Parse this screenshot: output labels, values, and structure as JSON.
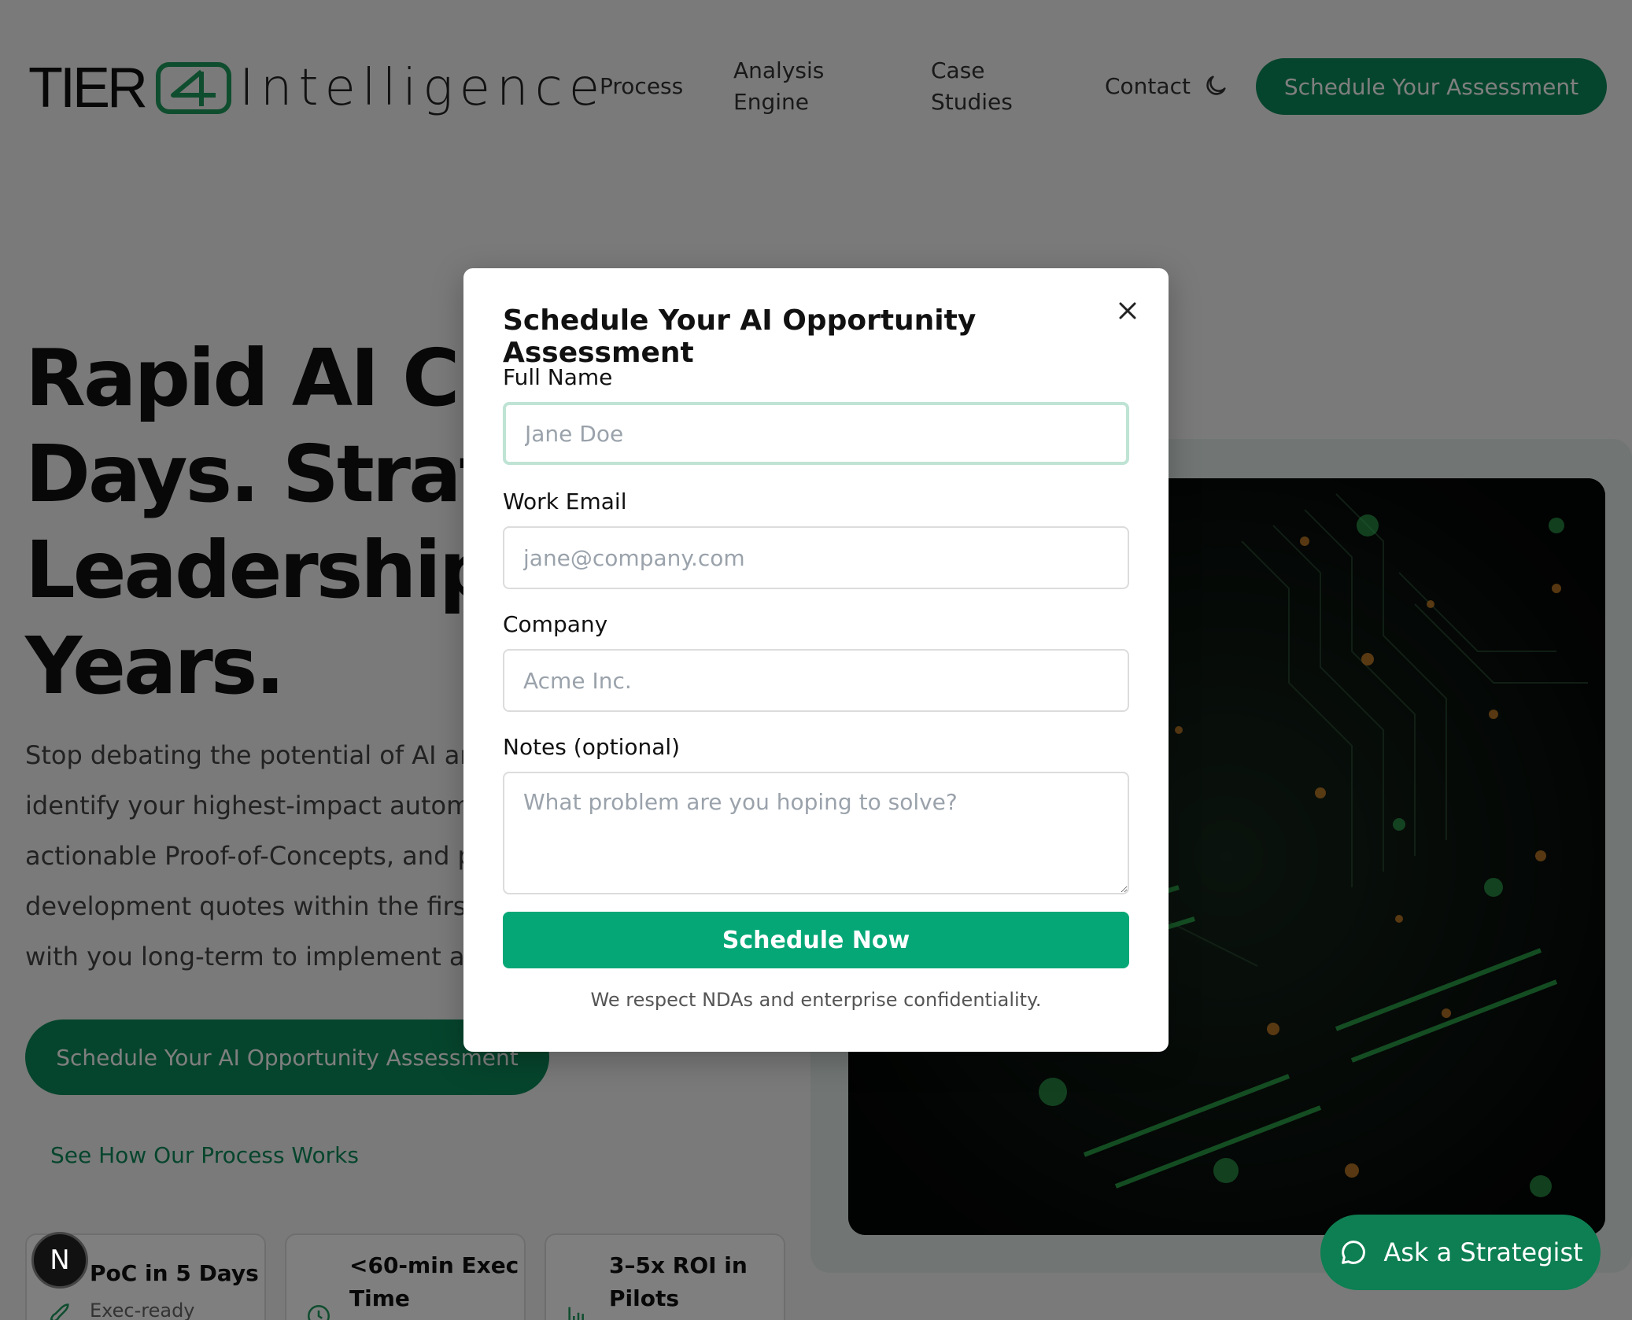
{
  "header": {
    "logo_tier": "TIER",
    "logo_intelligence": "Intelligence",
    "nav": {
      "process": "Process",
      "analysis_line1": "Analysis",
      "analysis_line2": "Engine",
      "case_line1": "Case",
      "case_line2": "Studies",
      "contact": "Contact"
    },
    "theme_toggle_icon": "moon-icon",
    "cta": "Schedule Your Assessment"
  },
  "hero": {
    "title_line1": "Rapid AI Cla",
    "title_line2": "Days. Strate",
    "title_line3": "Leadership",
    "title_line4": "Years.",
    "body_line1": "Stop debating the potential of AI anc",
    "body_line2": "identify your highest-impact automa",
    "body_line3": "actionable Proof-of-Concepts, and p",
    "body_line4": "development quotes within the first",
    "body_line5": "with you long-term to implement anc",
    "cta": "Schedule Your AI Opportunity Assessment",
    "link": "See How Our Process Works"
  },
  "stats": [
    {
      "title": "PoC in 5 Days",
      "sub": "Exec-ready",
      "icon": "rocket-icon"
    },
    {
      "title_line1": "<60-min Exec",
      "title_line2": "Time",
      "icon": "clock-icon"
    },
    {
      "title_line1": "3–5x ROI in",
      "title_line2": "Pilots",
      "icon": "bar-chart-icon"
    }
  ],
  "badge": "N",
  "ask": {
    "label": "Ask a Strategist",
    "icon": "chat-bubble-icon"
  },
  "modal": {
    "title": "Schedule Your AI Opportunity Assessment",
    "close_icon": "close-icon",
    "full_name_label": "Full Name",
    "full_name_placeholder": "Jane Doe",
    "email_label": "Work Email",
    "email_placeholder": "jane@company.com",
    "company_label": "Company",
    "company_placeholder": "Acme Inc.",
    "notes_label": "Notes (optional)",
    "notes_placeholder": "What problem are you hoping to solve?",
    "submit": "Schedule Now",
    "note": "We respect NDAs and enterprise confidentiality."
  },
  "colors": {
    "accent": "#0d8a5a",
    "submit": "#06a776",
    "focus_ring": "#bfe3d4"
  }
}
